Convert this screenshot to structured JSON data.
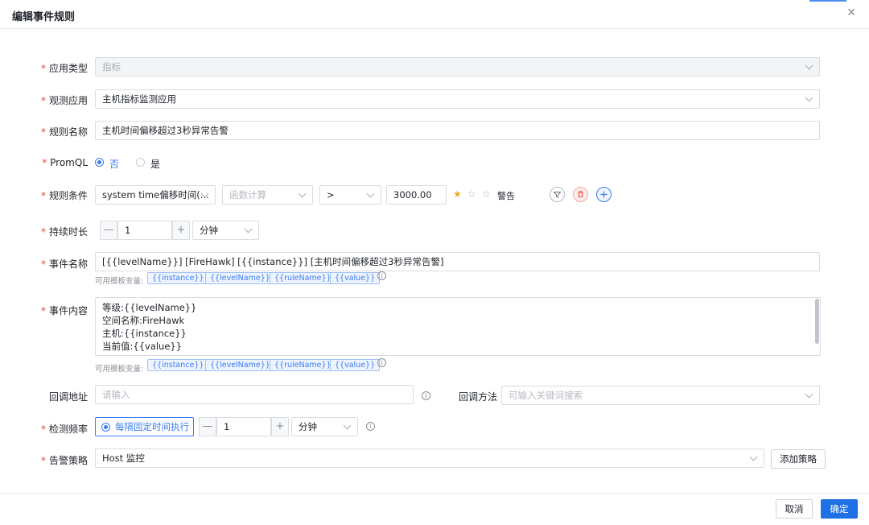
{
  "dialog": {
    "title": "编辑事件规则"
  },
  "form": {
    "app_type": {
      "label": "应用类型",
      "value": "指标"
    },
    "observe_app": {
      "label": "观测应用",
      "value": "主机指标监测应用"
    },
    "rule_name": {
      "label": "规则名称",
      "value": "主机时间偏移超过3秒异常告警"
    },
    "promql": {
      "label": "PromQL",
      "options": [
        "否",
        "是"
      ],
      "selected": "否"
    },
    "condition": {
      "label": "规则条件",
      "metric": "system time偏移时间(...",
      "func_placeholder": "函数计算",
      "operator": ">",
      "threshold": "3000.00",
      "level_stars": 1,
      "level_text": "警告"
    },
    "duration": {
      "label": "持续时长",
      "value": "1",
      "unit": "分钟",
      "minus": "—",
      "plus": "+"
    },
    "event_name": {
      "label": "事件名称",
      "value": "[{{levelName}}] [FireHawk] [{{instance}}] [主机时间偏移超过3秒异常告警]"
    },
    "template_vars": {
      "hint": "可用模板变量:",
      "tags": [
        "{{instance}}",
        "{{levelName}}",
        "{{ruleName}}",
        "{{value}}"
      ]
    },
    "event_content": {
      "label": "事件内容",
      "lines": [
        "等级:{{levelName}}",
        "空间名称:FireHawk",
        "主机:{{instance}}",
        "当前值:{{value}}"
      ]
    },
    "callback_url": {
      "label": "回调地址",
      "placeholder": "请输入"
    },
    "callback_method": {
      "label": "回调方法",
      "placeholder": "可输入关键词搜索"
    },
    "frequency": {
      "label": "检测频率",
      "mode": "每隔固定时间执行",
      "value": "1",
      "unit": "分钟",
      "minus": "—",
      "plus": "+"
    },
    "alert_policy": {
      "label": "告警策略",
      "value": "Host 监控",
      "add_label": "添加策略"
    }
  },
  "footer": {
    "cancel_label": "取消",
    "confirm_label": "确定"
  },
  "colors": {
    "primary": "#1f6fe5",
    "required": "#e8473b",
    "star": "#f5a623",
    "danger": "#e8473b"
  },
  "icons": {
    "close": "close-icon",
    "info": "info-icon",
    "filter": "filter-icon",
    "delete": "trash-icon",
    "add": "plus-circle-icon"
  }
}
